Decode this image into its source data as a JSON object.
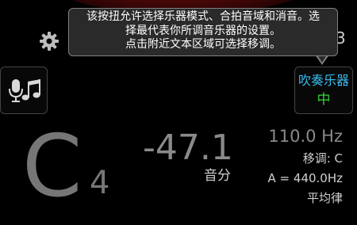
{
  "header": {
    "settings_icon": "gear-icon",
    "truncated_text": "3"
  },
  "tooltip": {
    "line1": "该按扭允许选择乐器模式、合拍音域和消音。选",
    "line2": "择最代表你所调音乐器的设置。",
    "line3": "点击附近文本区域可选择移调。"
  },
  "input_button": {
    "icons": [
      "microphone-icon",
      "music-note-icon"
    ]
  },
  "mode_button": {
    "label": "吹奏乐器",
    "value": "中"
  },
  "reading": {
    "note": "C",
    "octave": "4",
    "cents": "-47.1",
    "cents_unit": "音分",
    "frequency": "110.0 Hz",
    "transpose": "移调: C",
    "reference": "A = 440.0Hz",
    "temperament": "平均律"
  },
  "colors": {
    "background": "#000000",
    "mode_label": "#38bdf0",
    "mode_value": "#35d238",
    "tooltip_bg": "#2a2a2a",
    "tooltip_border": "#808080",
    "dim_text": "#767676"
  }
}
